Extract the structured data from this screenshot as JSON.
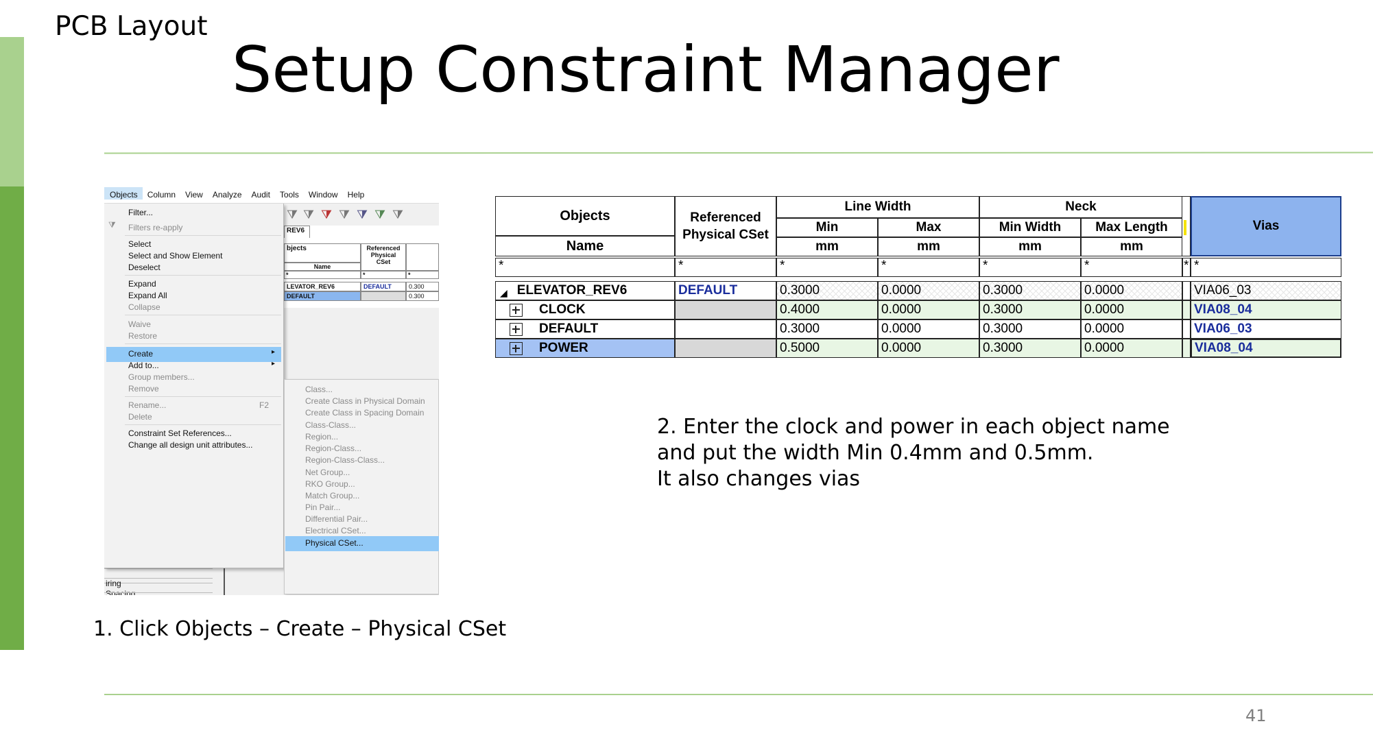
{
  "slide": {
    "section": "PCB Layout",
    "title": "Setup Constraint Manager",
    "page_number": "41",
    "caption_1": "1. Click Objects – Create – Physical CSet",
    "caption_2": [
      "2. Enter the clock and power in each object name",
      "and put the width Min 0.4mm and 0.5mm.",
      "It also changes vias"
    ],
    "colors": {
      "accent_light": "#a9d18e",
      "accent_dark": "#70ad47",
      "menu_highlight": "#91c9f7"
    }
  },
  "menubar": [
    "Objects",
    "Column",
    "View",
    "Analyze",
    "Audit",
    "Tools",
    "Window",
    "Help"
  ],
  "objects_menu": {
    "items": [
      {
        "label": "Filter...",
        "enabled": true
      },
      {
        "label": "Filters re-apply",
        "enabled": false
      },
      {
        "label": "Select",
        "enabled": true
      },
      {
        "label": "Select and Show Element",
        "enabled": true
      },
      {
        "label": "Deselect",
        "enabled": true
      },
      {
        "label": "Expand",
        "enabled": true
      },
      {
        "label": "Expand All",
        "enabled": true
      },
      {
        "label": "Collapse",
        "enabled": false
      },
      {
        "label": "Waive",
        "enabled": false
      },
      {
        "label": "Restore",
        "enabled": false
      },
      {
        "label": "Create",
        "enabled": true,
        "selected": true
      },
      {
        "label": "Add to...",
        "enabled": true
      },
      {
        "label": "Group members...",
        "enabled": false
      },
      {
        "label": "Remove",
        "enabled": false
      },
      {
        "label": "Rename...",
        "enabled": false,
        "shortcut": "F2"
      },
      {
        "label": "Delete",
        "enabled": false
      },
      {
        "label": "Constraint Set References...",
        "enabled": true
      },
      {
        "label": "Change all design unit attributes...",
        "enabled": true
      }
    ]
  },
  "create_submenu": [
    "Class...",
    "Create Class in Physical Domain",
    "Create Class in Spacing Domain",
    "Class-Class...",
    "Region...",
    "Region-Class...",
    "Region-Class-Class...",
    "Net Group...",
    "RKO Group...",
    "Match Group...",
    "Pin Pair...",
    "Differential Pair...",
    "Electrical CSet...",
    "Physical CSet..."
  ],
  "background_panel": {
    "tab": "REV6",
    "header_objects": "bjects",
    "header_name": "Name",
    "header_ref": [
      "Referenced",
      "Physical CSet"
    ],
    "star": "*",
    "rows": [
      {
        "name": "LEVATOR_REV6",
        "ref": "DEFAULT",
        "val": "0.300"
      },
      {
        "name": "DEFAULT",
        "ref": "",
        "val": "0.300"
      }
    ],
    "side_labels": [
      "Spacing",
      "iring"
    ]
  },
  "constraint_table": {
    "headers": {
      "objects": "Objects",
      "name": "Name",
      "referenced": [
        "Referenced",
        "Physical CSet"
      ],
      "line_width": "Line Width",
      "neck": "Neck",
      "min": "Min",
      "max": "Max",
      "min_width": "Min Width",
      "max_length": "Max Length",
      "unit": "mm",
      "vias": "Vias",
      "filter": "*"
    },
    "rows": [
      {
        "name": "ELEVATOR_REV6",
        "ref": "DEFAULT",
        "lw_min": "0.3000",
        "lw_max": "0.0000",
        "neck_min": "0.3000",
        "neck_max": "0.0000",
        "vias": "VIA06_03"
      },
      {
        "name": "CLOCK",
        "ref": "",
        "lw_min": "0.4000",
        "lw_max": "0.0000",
        "neck_min": "0.3000",
        "neck_max": "0.0000",
        "vias": "VIA08_04"
      },
      {
        "name": "DEFAULT",
        "ref": "",
        "lw_min": "0.3000",
        "lw_max": "0.0000",
        "neck_min": "0.3000",
        "neck_max": "0.0000",
        "vias": "VIA06_03"
      },
      {
        "name": "POWER",
        "ref": "",
        "lw_min": "0.5000",
        "lw_max": "0.0000",
        "neck_min": "0.3000",
        "neck_max": "0.0000",
        "vias": "VIA08_04"
      }
    ]
  }
}
